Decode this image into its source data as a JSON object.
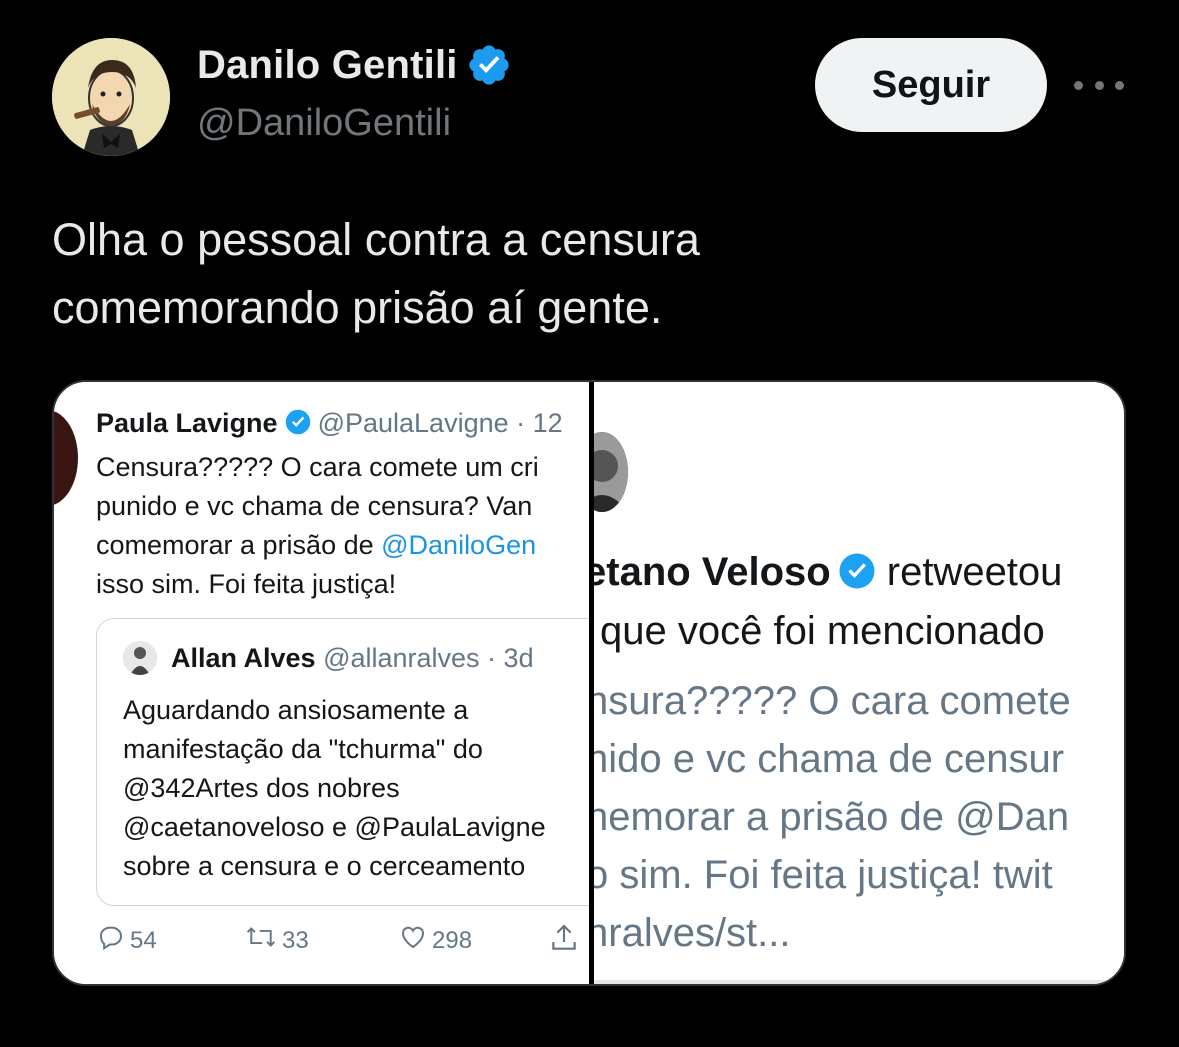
{
  "author": {
    "name": "Danilo Gentili",
    "handle": "@DaniloGentili",
    "verified": true
  },
  "follow_button": {
    "label": "Seguir"
  },
  "tweet": {
    "text_lines": [
      "Olha o pessoal contra a censura",
      "comemorando prisão aí gente."
    ]
  },
  "colors": {
    "verified": "#1d9bf0",
    "link": "#1b95e0",
    "background": "#000000"
  },
  "icons": [
    "verified-badge-icon",
    "more-icon",
    "reply-icon",
    "retweet-icon",
    "like-icon",
    "share-icon"
  ],
  "media": {
    "left": {
      "name": "Paula Lavigne",
      "handle_time": "@PaulaLavigne · 12",
      "lines": [
        "Censura????? O cara comete um cri",
        "punido e vc chama de censura? Van",
        "comemorar a prisão de ",
        "isso sim. Foi feita justiça!"
      ],
      "mention": "@DaniloGen",
      "quoted": {
        "name": "Allan Alves",
        "handle_time": "@allanralves · 3d",
        "lines": [
          "Aguardando ansiosamente a",
          "manifestação da \"tchurma\" do",
          "@342Artes dos nobres",
          "@caetanoveloso e @PaulaLavigne",
          "sobre a censura e o cerceamento"
        ]
      },
      "counts": {
        "replies": "54",
        "retweets": "33",
        "likes": "298"
      }
    },
    "right": {
      "name_fragment": "etano Veloso",
      "action": "retweetou",
      "line2": "que você foi mencionado",
      "quote_lines": [
        "nsura????? O cara comete",
        "nido e vc chama de censur",
        "nemorar a prisão de @Dan",
        "o sim. Foi feita justiça! twit",
        "nralves/st..."
      ]
    }
  }
}
